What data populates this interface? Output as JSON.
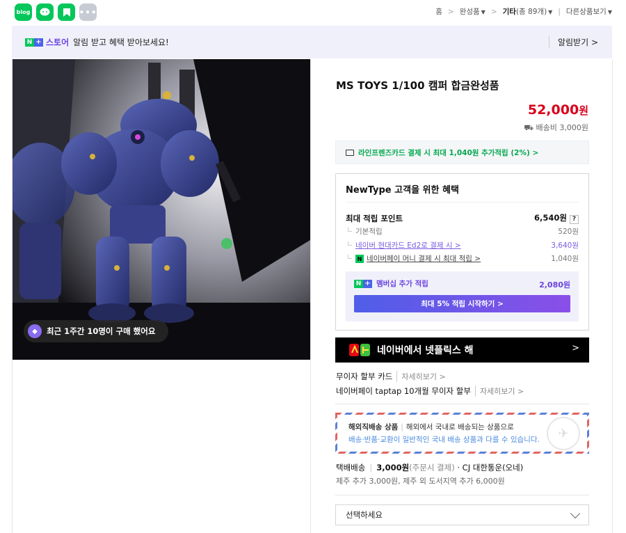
{
  "sns": {
    "blog_label": "blog",
    "more_label": "•••"
  },
  "breadcrumb": {
    "home": "홈",
    "sep": ">",
    "category": "완성품",
    "current": "기타",
    "count_text": "(총 89개)",
    "other": "다른상품보기"
  },
  "banner": {
    "badge_n": "N",
    "badge_plus": "+",
    "store": "스토어",
    "message": "알림 받고 혜택 받아보세요!",
    "alarm_button": "알림받기 >"
  },
  "image": {
    "recent_badge": "최근 1주간 10명이 구매 했어요"
  },
  "product": {
    "title": "MS TOYS 1/100 캠퍼 합금완성품",
    "price": "52,000",
    "price_unit": "원",
    "shipping_fee": "배송비 3,000원"
  },
  "card_promo": "라인프렌즈카드 결제 시 최대 1,040원 추가적립 (2%) >",
  "benefit": {
    "heading": "NewType 고객을 위한 혜택",
    "max_label": "최대 적립 포인트",
    "max_value": "6,540원",
    "help": "?",
    "rows": [
      {
        "label": "기본적립",
        "value": "520원"
      },
      {
        "label": "네이버 현대카드 Ed2로 결제 시 >",
        "value": "3,640원"
      },
      {
        "label": "네이버페이 머니 결제 시 최대 적립 >",
        "value": "1,040원"
      }
    ],
    "member_label": "멤버십 추가 적립",
    "member_value": "2,080원",
    "member_button": "최대 5% 적립 시작하기 >"
  },
  "netflix": {
    "text": "네이버에서 넷플릭스 해",
    "arrow": ">"
  },
  "installment": [
    {
      "label": "무이자 할부 카드",
      "more": "자세히보기 >"
    },
    {
      "label": "네이버페이 taptap 10개월 무이자 할부",
      "more": "자세히보기 >"
    }
  ],
  "overseas": {
    "title": "해외직배송 상품",
    "desc": "해외에서 국내로 배송되는 상품으로",
    "note": "배송·반품·교환이 일반적인 국내 배송 상품과 다를 수 있습니다."
  },
  "delivery": {
    "type": "택배배송",
    "fee": "3,000원",
    "pay_note": "(주문시 결제)",
    "carrier": "· CJ 대한통운(오네)",
    "extra": "제주 추가 3,000원, 제주 외 도서지역 추가 6,000원"
  },
  "option_select": {
    "placeholder": "선택하세요"
  },
  "colors": {
    "price": "#d9001b",
    "naver_green": "#03c75a",
    "membership_purple": "#6a43e0"
  }
}
